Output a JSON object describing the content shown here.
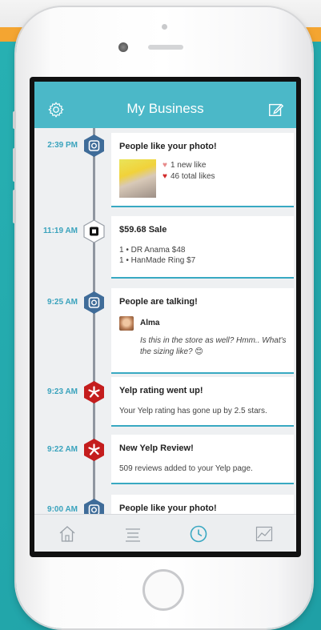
{
  "app": {
    "title": "My Business"
  },
  "icons": {
    "settings": "gear-icon",
    "compose": "compose-icon",
    "instagram": "instagram-icon",
    "square": "square-icon",
    "yelp": "yelp-icon"
  },
  "colors": {
    "accent": "#4bb8c8",
    "timestamp": "#3aa3bd",
    "yelp": "#c41d1d",
    "instagram": "#3f6c99"
  },
  "feed": [
    {
      "time": "2:39 PM",
      "source": "instagram",
      "title": "People like your photo!",
      "new_like": "1 new like",
      "total_likes": "46 total likes"
    },
    {
      "time": "11:19 AM",
      "source": "square",
      "title": "$59.68 Sale",
      "items": [
        "1 • DR Anama $48",
        "1 • HanMade Ring $7"
      ]
    },
    {
      "time": "9:25 AM",
      "source": "instagram",
      "title": "People are talking!",
      "user": "Alma",
      "comment": "Is this in the store as well?  Hmm.. What's the sizing like? 😊"
    },
    {
      "time": "9:23 AM",
      "source": "yelp",
      "title": "Yelp rating went up!",
      "text": "Your Yelp rating has gone up by 2.5 stars."
    },
    {
      "time": "9:22 AM",
      "source": "yelp",
      "title": "New Yelp Review!",
      "text": "509 reviews added to your Yelp page."
    },
    {
      "time": "9:00 AM",
      "source": "instagram",
      "title": "People like your photo!"
    }
  ],
  "tabs": [
    {
      "name": "home",
      "icon": "home-icon",
      "active": false
    },
    {
      "name": "menu",
      "icon": "list-icon",
      "active": false
    },
    {
      "name": "activity",
      "icon": "clock-icon",
      "active": true
    },
    {
      "name": "stats",
      "icon": "chart-icon",
      "active": false
    }
  ]
}
